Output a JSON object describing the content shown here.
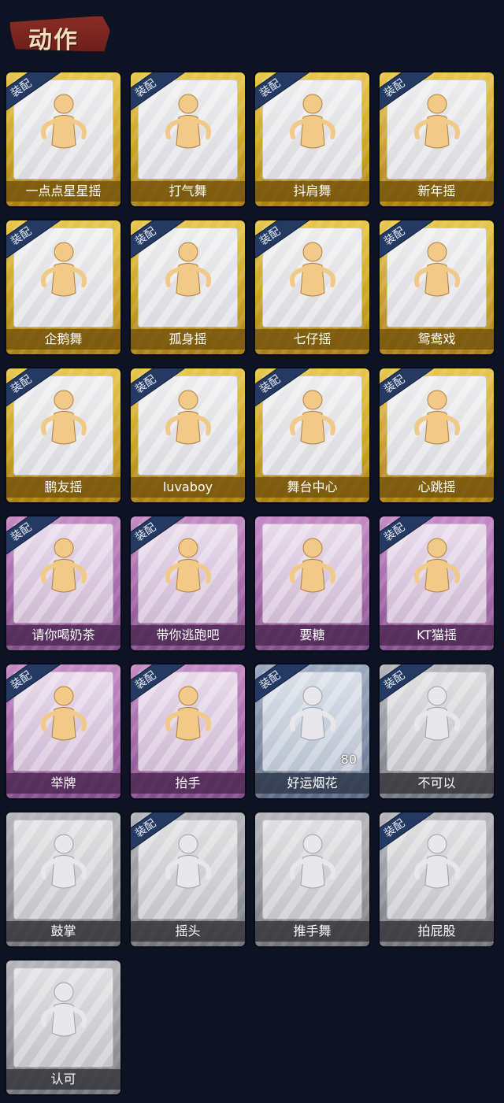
{
  "header": {
    "title": "动作"
  },
  "badge_label": "装配",
  "cards": [
    {
      "label": "一点点星星摇",
      "tier": "gold",
      "equipped": true
    },
    {
      "label": "打气舞",
      "tier": "gold",
      "equipped": true
    },
    {
      "label": "抖肩舞",
      "tier": "gold",
      "equipped": true
    },
    {
      "label": "新年摇",
      "tier": "gold",
      "equipped": true
    },
    {
      "label": "企鹅舞",
      "tier": "gold",
      "equipped": true
    },
    {
      "label": "孤身摇",
      "tier": "gold",
      "equipped": true
    },
    {
      "label": "七仔摇",
      "tier": "gold",
      "equipped": true
    },
    {
      "label": "鸳鸯戏",
      "tier": "gold",
      "equipped": true
    },
    {
      "label": "鹏友摇",
      "tier": "gold",
      "equipped": true
    },
    {
      "label": "luvaboy",
      "tier": "gold",
      "equipped": true
    },
    {
      "label": "舞台中心",
      "tier": "gold",
      "equipped": true
    },
    {
      "label": "心跳摇",
      "tier": "gold",
      "equipped": true
    },
    {
      "label": "请你喝奶茶",
      "tier": "purple",
      "equipped": true
    },
    {
      "label": "带你逃跑吧",
      "tier": "purple",
      "equipped": true
    },
    {
      "label": "要糖",
      "tier": "purple",
      "equipped": false
    },
    {
      "label": "KT猫摇",
      "tier": "purple",
      "equipped": true
    },
    {
      "label": "举牌",
      "tier": "purple",
      "equipped": true
    },
    {
      "label": "抬手",
      "tier": "purple",
      "equipped": true
    },
    {
      "label": "好运烟花",
      "tier": "blue",
      "equipped": true,
      "count": "80"
    },
    {
      "label": "不可以",
      "tier": "gray",
      "equipped": true
    },
    {
      "label": "鼓掌",
      "tier": "gray",
      "equipped": false
    },
    {
      "label": "摇头",
      "tier": "gray",
      "equipped": true
    },
    {
      "label": "推手舞",
      "tier": "gray",
      "equipped": false
    },
    {
      "label": "拍屁股",
      "tier": "gray",
      "equipped": true
    },
    {
      "label": "认可",
      "tier": "gray",
      "equipped": false
    }
  ]
}
